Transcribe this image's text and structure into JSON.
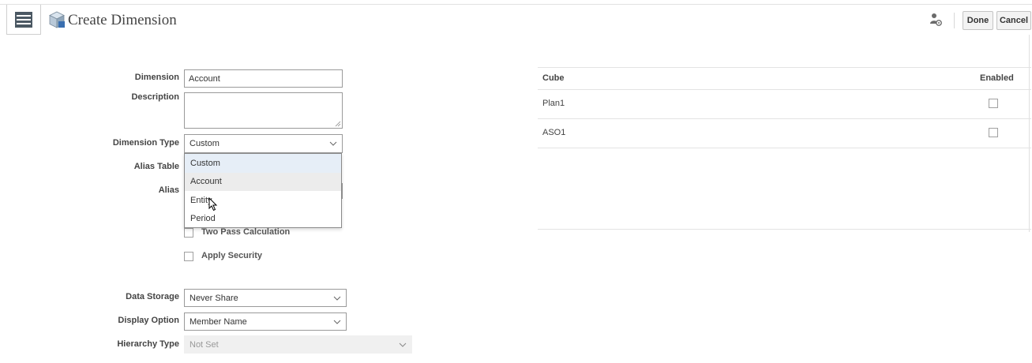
{
  "header": {
    "title": "Create Dimension",
    "done_label": "Done",
    "cancel_label": "Cancel"
  },
  "form": {
    "dimension": {
      "label": "Dimension",
      "value": "Account"
    },
    "description": {
      "label": "Description",
      "value": ""
    },
    "dimension_type": {
      "label": "Dimension Type",
      "value": "Custom",
      "options": [
        "Custom",
        "Account",
        "Entity",
        "Period"
      ],
      "selected_index": 0,
      "hover_index": 1
    },
    "alias_table": {
      "label": "Alias Table"
    },
    "alias": {
      "label": "Alias"
    },
    "two_pass": {
      "label": "Two Pass Calculation",
      "checked": false
    },
    "apply_security": {
      "label": "Apply Security",
      "checked": false
    },
    "data_storage": {
      "label": "Data Storage",
      "value": "Never Share"
    },
    "display_option": {
      "label": "Display Option",
      "value": "Member Name"
    },
    "hierarchy_type": {
      "label": "Hierarchy Type",
      "value": "Not Set"
    }
  },
  "cube_table": {
    "headers": {
      "cube": "Cube",
      "enabled": "Enabled"
    },
    "rows": [
      {
        "cube": "Plan1",
        "enabled": false
      },
      {
        "cube": "ASO1",
        "enabled": false
      }
    ]
  },
  "icons": {
    "menu": "menu-icon",
    "cube": "cube-icon",
    "user": "user-settings-icon",
    "chevron": "chevron-down-icon",
    "cursor": "mouse-pointer-icon"
  }
}
